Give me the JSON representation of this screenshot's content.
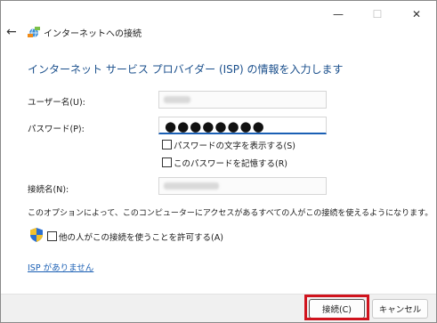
{
  "window": {
    "title": "インターネットへの接続",
    "minimize_glyph": "—",
    "maximize_glyph": "☐",
    "close_glyph": "✕",
    "back_glyph": "←"
  },
  "heading": "インターネット サービス プロバイダー (ISP) の情報を入力します",
  "form": {
    "username_label": "ユーザー名(U):",
    "password_label": "パスワード(P):",
    "password_dots": "●●●●●●●●",
    "show_password": "パスワードの文字を表示する(S)",
    "remember_password": "このパスワードを記憶する(R)",
    "connection_name_label": "接続名(N):"
  },
  "note": "このオプションによって、このコンピューターにアクセスがあるすべての人がこの接続を使えるようになります。",
  "allow_others": "他の人がこの接続を使うことを許可する(A)",
  "no_isp_link": "ISP がありません",
  "buttons": {
    "connect": "接続(C)",
    "cancel": "キャンセル"
  },
  "colors": {
    "heading": "#1a4f8c",
    "link": "#1a5fb4",
    "highlight": "#d0141e"
  },
  "icons": [
    "back-arrow-icon",
    "network-icon",
    "shield-icon"
  ]
}
